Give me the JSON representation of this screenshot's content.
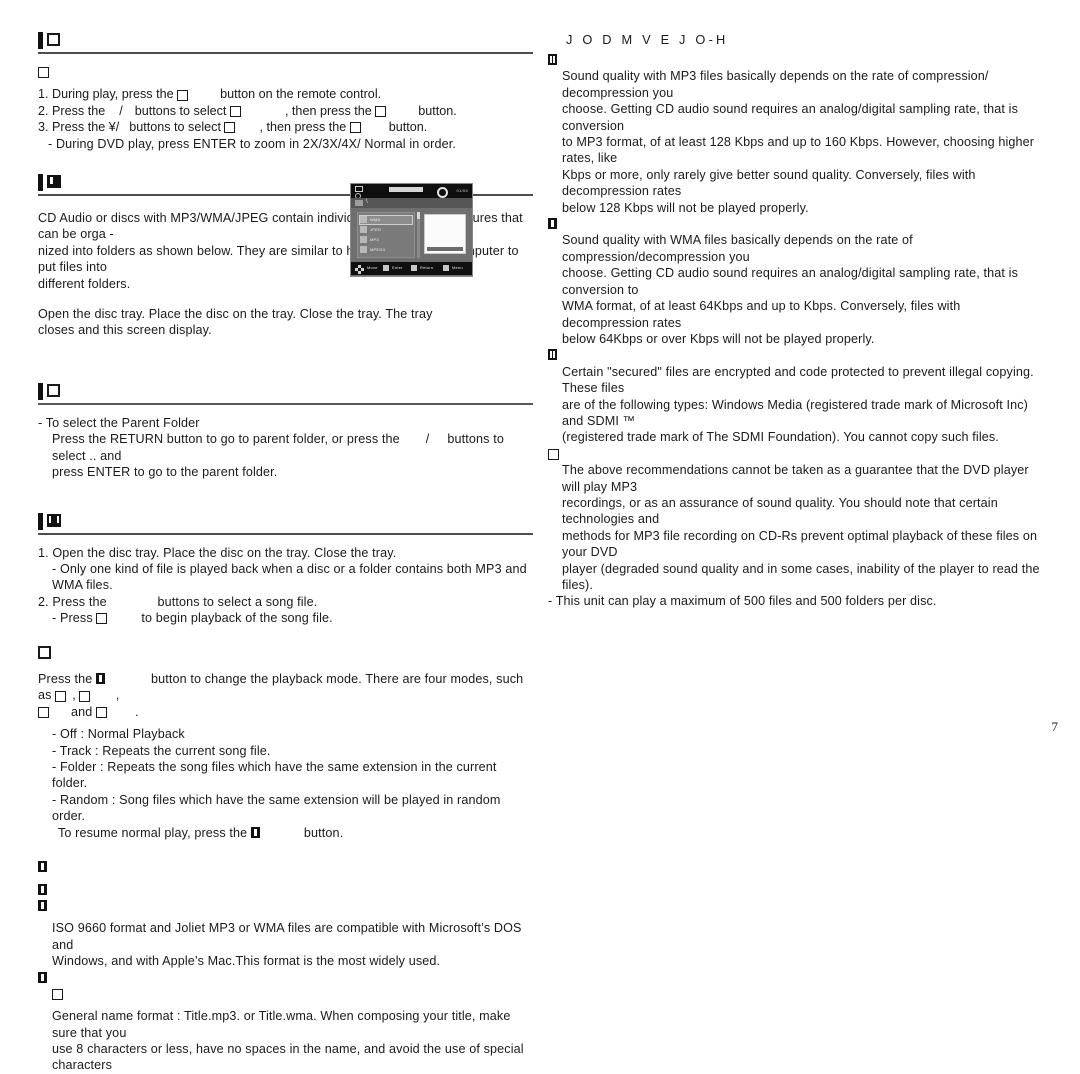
{
  "document": {
    "page_number": "7",
    "language_note": "scanned manual page with unreadable/missing glyphs shown as boxes"
  },
  "left_column": {
    "section_zoom": {
      "heading_glyph": "missing-glyph-box",
      "sub_glyph": "missing-glyph-box",
      "steps": [
        {
          "num": "1.",
          "before": "During play, press the",
          "glyph": "missing-glyph-box",
          "after": "button on the remote control."
        },
        {
          "num": "2.",
          "before": "Press the",
          "arrows": "/",
          "mid": "buttons to select",
          "glyph": "missing-glyph-box",
          "mid2": ", then press the",
          "glyph2": "missing-glyph-box",
          "after": "button."
        },
        {
          "num": "3.",
          "before": "Press the",
          "arrows": "¥/",
          "mid": "buttons to select",
          "glyph": "missing-glyph-box",
          "mid2": ", then press the",
          "glyph2": "missing-glyph-box",
          "after": "button."
        }
      ],
      "note": "- During DVD play, press ENTER to zoom in 2X/3X/4X/ Normal in order."
    },
    "section_folders": {
      "heading_glyph": "black-glyph-chip",
      "para1": "CD Audio or discs with MP3/WMA/JPEG contain individual songs and/or pictures that can be orga -",
      "para1b": "nized into folders as shown below. They are similar to how you use your computer to put files into",
      "para1c": "different folders.",
      "para2": "Open the disc tray. Place the disc on the tray. Close the tray. The tray",
      "para2b": "closes and this screen display."
    },
    "section_parent": {
      "heading_glyph": "missing-glyph-box",
      "line1": "- To select the Parent Folder",
      "line2a": "Press the RETURN button to go to parent folder, or press the",
      "line2_arrows": "/",
      "line2b": "buttons to select",
      "line2c": "..",
      "line2d": "and",
      "line3": "press ENTER to go to the parent folder."
    },
    "section_playback": {
      "heading_glyph": "black-glyph-chip",
      "steps": [
        "1. Open the disc tray. Place the disc on the tray. Close the tray.",
        "- Only one kind of file is played back when a disc or a folder contains both MP3 and WMA files.",
        "2. Press the              buttons to select a song file."
      ],
      "press_line_a": "- Press",
      "press_glyph": "missing-glyph-box",
      "press_line_b": "to begin playback of the song file."
    },
    "section_repeat": {
      "heading_glyph": "missing-glyph-box",
      "lead_a": "Press the",
      "lead_glyph": "black-glyph-chip",
      "lead_b": "button to change the playback mode. There are four modes, such as",
      "mode1": "missing-glyph-box",
      "mode2": "missing-glyph-box",
      "mode3": "missing-glyph-box",
      "and_word": "and",
      "mode4": "missing-glyph-box",
      "bullets": [
        "- Off : Normal Playback",
        "- Track : Repeats the current song file.",
        "- Folder : Repeats the song files which have the same extension in the current folder.",
        "- Random : Song files which have the same extension will be played in random order."
      ],
      "resume_a": "To resume normal play, press the",
      "resume_glyph": "black-glyph-chip",
      "resume_b": "button."
    },
    "section_cdr": {
      "heading_glyph": "black-glyph-chip",
      "sub_glyph_1": "black-glyph-chip",
      "sub_glyph_2": "black-glyph-chip",
      "iso_line1": "ISO 9660 format and Joliet MP3 or WMA files are compatible with Microsoft’s DOS and",
      "iso_line2": "Windows, and with Apple’s Mac.This format is the most widely used.",
      "sub_glyph_3": "black-glyph-chip",
      "sub_glyph_4": "missing-glyph-box",
      "name_line1": "General name format : Title.mp3. or Title.wma. When composing your title, make sure that you",
      "name_line2": "use 8 characters or less, have no spaces in the name, and avoid the use of special characters"
    }
  },
  "right_column": {
    "title": "J O D M V E J O-H",
    "blocks": [
      {
        "glyph": "black-glyph-chip",
        "lines": [
          "Sound quality with MP3 files basically depends on the rate of compression/ decompression you",
          "choose. Getting CD audio sound requires an analog/digital sampling rate, that is conversion",
          "to MP3 format, of at least 128 Kbps and up to 160 Kbps. However, choosing higher rates, like",
          "Kbps or more, only rarely give better sound quality. Conversely, files with decompression rates",
          "below 128 Kbps will not be played properly."
        ]
      },
      {
        "glyph": "black-glyph-chip",
        "lines": [
          "Sound quality with WMA files basically depends on the rate of compression/decompression you",
          "choose. Getting CD audio sound requires an analog/digital sampling rate, that is conversion to",
          "WMA format, of at least 64Kbps and up to Kbps. Conversely, files with decompression rates",
          "below 64Kbps or over Kbps will not be played properly."
        ]
      },
      {
        "glyph": "black-glyph-chip",
        "lines": [
          "Certain \"secured\" files are encrypted and code protected to prevent illegal copying. These files",
          "are of the following types: Windows Media (registered trade mark of Microsoft Inc) and SDMI ™",
          "(registered trade mark of The SDMI Foundation). You cannot copy such files."
        ]
      },
      {
        "glyph": "missing-glyph-box",
        "lines": [
          "The above recommendations cannot be taken as a guarantee that the DVD player will play MP3",
          "recordings, or as an assurance of sound quality. You should note that certain technologies and",
          "methods for MP3 file recording on CD-Rs prevent optimal playback of these files on your DVD",
          "player (degraded sound quality and in some cases, inability of the player to read the files)."
        ]
      }
    ],
    "footer_note": "- This unit can play a maximum of 500 files and 500 folders per disc."
  },
  "osd_screenshot": {
    "name": "disc-file-browser-osd",
    "path_separator": "\\",
    "file_rows": [
      "WMA",
      "JPEG",
      "MP3",
      "MPEG4"
    ],
    "selected_row": "WMA",
    "bottom_keys": [
      "Move",
      "Enter",
      "Return",
      "Menu"
    ],
    "time_display": "01/04"
  }
}
